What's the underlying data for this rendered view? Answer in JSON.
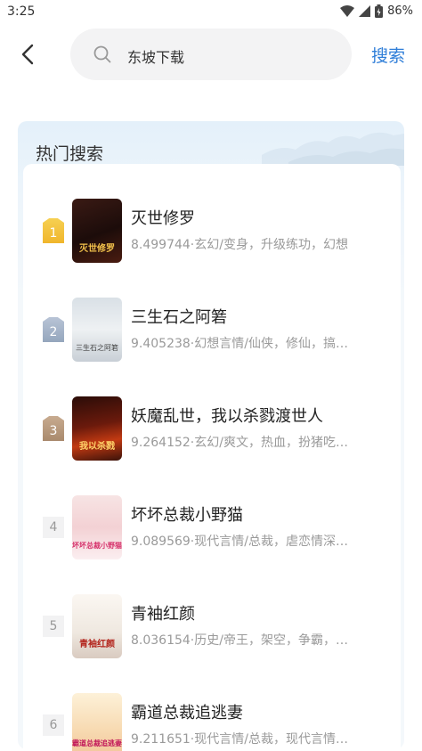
{
  "status": {
    "time": "3:25",
    "battery": "86%"
  },
  "search": {
    "query": "东坡下载",
    "action_label": "搜索"
  },
  "hot": {
    "title": "热门搜索",
    "items": [
      {
        "rank": "1",
        "title": "灭世修罗",
        "meta": "8.499744·玄幻/变身，升级练功，幻想",
        "cover_text": "灭世修罗"
      },
      {
        "rank": "2",
        "title": "三生石之阿箬",
        "meta": "9.405238·幻想言情/仙侠，修仙，搞…",
        "cover_text": "三生石之阿箬"
      },
      {
        "rank": "3",
        "title": "妖魔乱世，我以杀戮渡世人",
        "meta": "9.264152·玄幻/爽文，热血，扮猪吃…",
        "cover_text": "我以杀戮"
      },
      {
        "rank": "4",
        "title": "坏坏总裁小野猫",
        "meta": "9.089569·现代言情/总裁，虐恋情深…",
        "cover_text": "坏坏总裁小野猫"
      },
      {
        "rank": "5",
        "title": "青袖红颜",
        "meta": "8.036154·历史/帝王，架空，争霸，…",
        "cover_text": "青袖红颜"
      },
      {
        "rank": "6",
        "title": "霸道总裁追逃妻",
        "meta": "9.211651·现代言情/总裁，现代言情…",
        "cover_text": "霸道总裁追逃妻"
      }
    ]
  }
}
